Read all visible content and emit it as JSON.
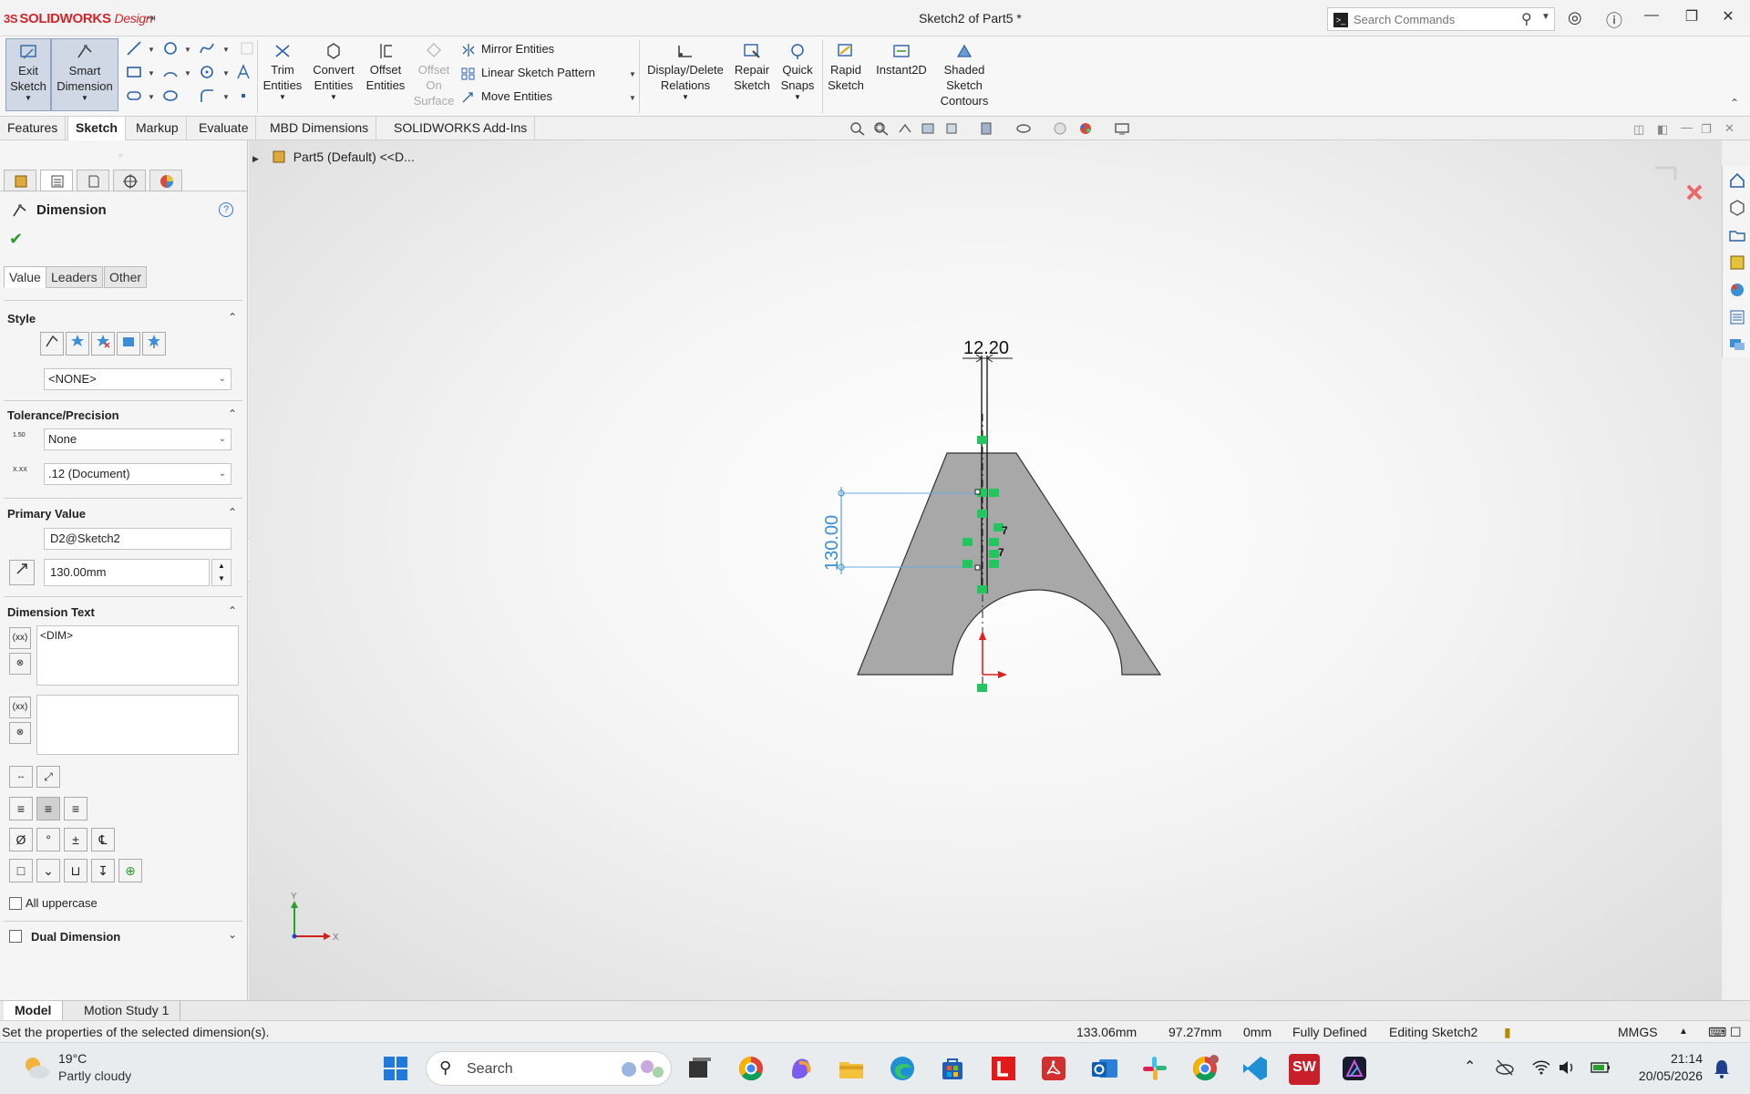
{
  "titlebar": {
    "logo_ds": "3S",
    "logo_brand": "SOLIDWORKS",
    "logo_suffix": "Design",
    "title": "Sketch2 of Part5 *",
    "search_placeholder": "Search Commands"
  },
  "ribbon": {
    "exit_sketch": [
      "Exit",
      "Sketch"
    ],
    "smart_dimension": [
      "Smart",
      "Dimension"
    ],
    "trim": [
      "Trim",
      "Entities"
    ],
    "convert": [
      "Convert",
      "Entities"
    ],
    "offset": [
      "Offset",
      "Entities"
    ],
    "offset_surface": [
      "Offset",
      "On",
      "Surface"
    ],
    "mirror": "Mirror Entities",
    "linear_pattern": "Linear Sketch Pattern",
    "move": "Move Entities",
    "display_relations": [
      "Display/Delete",
      "Relations"
    ],
    "repair": [
      "Repair",
      "Sketch"
    ],
    "quick_snaps": [
      "Quick",
      "Snaps"
    ],
    "rapid": [
      "Rapid",
      "Sketch"
    ],
    "instant2d": "Instant2D",
    "shaded": [
      "Shaded",
      "Sketch",
      "Contours"
    ]
  },
  "tabs": [
    "Features",
    "Sketch",
    "Markup",
    "Evaluate",
    "MBD Dimensions",
    "SOLIDWORKS Add-Ins"
  ],
  "active_tab": "Sketch",
  "tree": {
    "crumb": "Part5 (Default) <<D..."
  },
  "property_manager": {
    "title": "Dimension",
    "help": "?",
    "subtabs": [
      "Value",
      "Leaders",
      "Other"
    ],
    "style": {
      "header": "Style",
      "combo": "<NONE>"
    },
    "tolerance": {
      "header": "Tolerance/Precision",
      "type": "None",
      "precision": ".12 (Document)",
      "tol_icon_label": "1.50",
      "prec_icon_label": "X.XX"
    },
    "primary": {
      "header": "Primary Value",
      "name": "D2@Sketch2",
      "value": "130.00mm"
    },
    "dimtext": {
      "header": "Dimension Text",
      "text": "<DIM>"
    },
    "symbols": [
      "Ø",
      "°",
      "±",
      "℄"
    ],
    "all_uppercase": "All uppercase",
    "dual_dimension": "Dual Dimension"
  },
  "sketch": {
    "dim_horizontal": "12.20",
    "dim_vertical": "130.00",
    "axis_x": "X",
    "axis_y": "Y",
    "relation_glyph": "7"
  },
  "model_tabs": [
    "Model",
    "Motion Study 1"
  ],
  "status": {
    "message": "Set the properties of the selected dimension(s).",
    "x": "133.06mm",
    "y": "97.27mm",
    "z": "0mm",
    "state": "Fully Defined",
    "editing": "Editing Sketch2",
    "units": "MMGS"
  },
  "taskbar": {
    "weather_temp": "19°C",
    "weather_desc": "Partly cloudy",
    "search": "Search",
    "sw_badge": "SW",
    "time": "21:14",
    "date": "20/05/2026"
  },
  "colors": {
    "brand_red": "#d0262b",
    "dim_blue": "#3b8fd6",
    "relation_green": "#22c55e",
    "part_gray": "#a8a8a8"
  }
}
